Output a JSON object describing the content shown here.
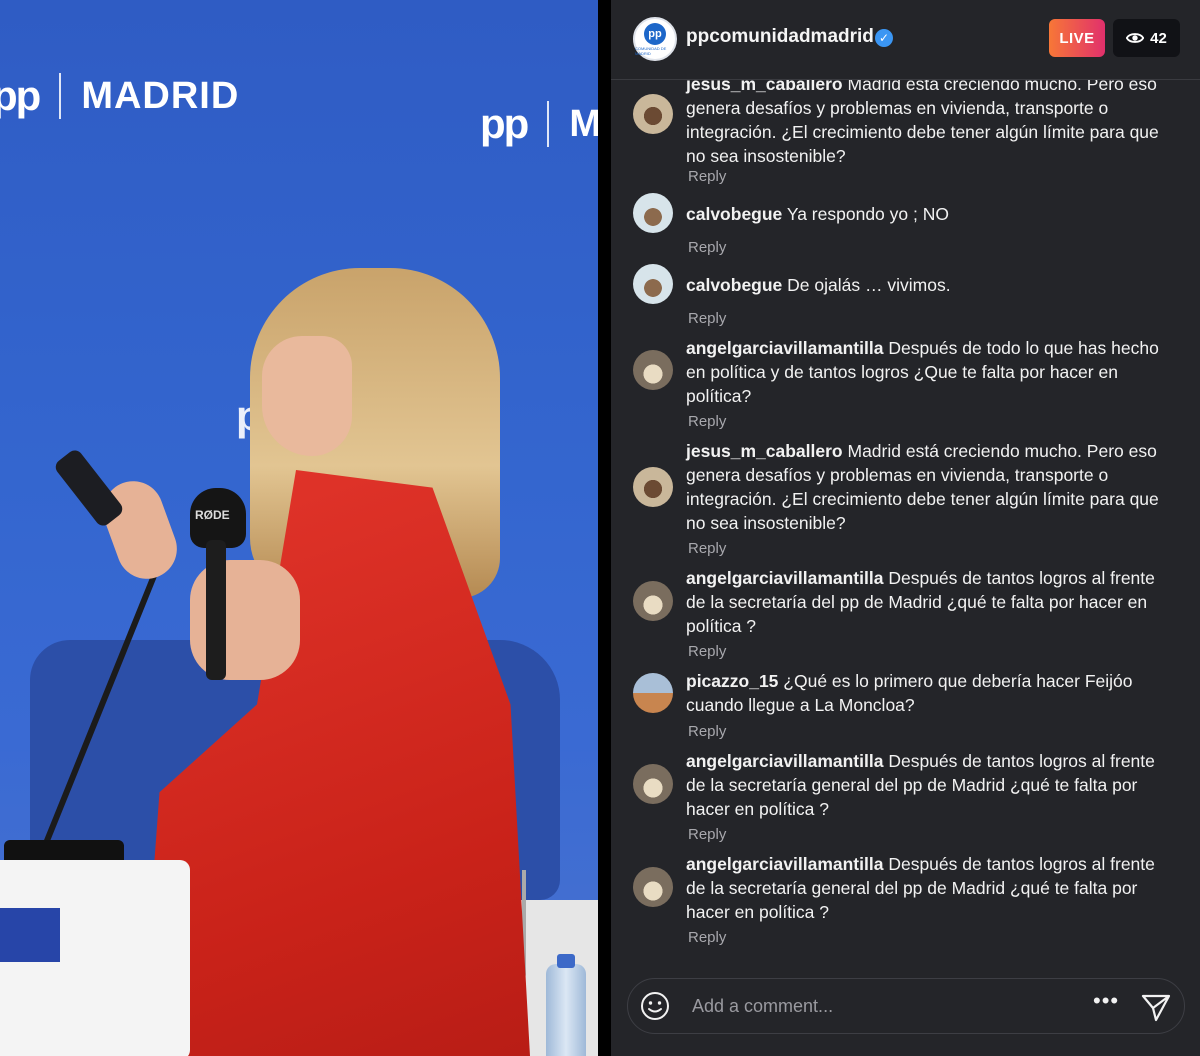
{
  "video": {
    "brand_mark": "pp",
    "brand_city": "MADRID",
    "mic_brand": "RØDE"
  },
  "header": {
    "username": "ppcomunidadmadrid",
    "live_label": "LIVE",
    "viewer_count": "42",
    "avatar_monogram": "pp",
    "avatar_caption": "COMUNIDAD DE MADRID"
  },
  "comments": [
    {
      "user": "jesus_m_caballero",
      "text": "Madrid está creciendo mucho. Pero eso genera desafíos y problemas en vivienda, transporte o integración. ¿El crecimiento debe tener algún límite para que no sea insostenible?",
      "reply": "Reply"
    },
    {
      "user": "calvobegue",
      "text": "Ya respondo yo ; NO",
      "reply": "Reply"
    },
    {
      "user": "calvobegue",
      "text": "De ojalás … vivimos.",
      "reply": "Reply"
    },
    {
      "user": "angelgarciavillamantilla",
      "text": "Después de todo lo que has hecho en política y de tantos logros ¿Que te falta por hacer en política?",
      "reply": "Reply"
    },
    {
      "user": "jesus_m_caballero",
      "text": "Madrid está creciendo mucho. Pero eso genera desafíos y problemas en vivienda, transporte o integración. ¿El crecimiento debe tener algún límite para que no sea insostenible?",
      "reply": "Reply"
    },
    {
      "user": "angelgarciavillamantilla",
      "text": "Después de tantos logros al frente de la secretaría del pp de Madrid ¿qué te falta por hacer en política ?",
      "reply": "Reply"
    },
    {
      "user": "picazzo_15",
      "text": "¿Qué es lo primero que debería hacer Feijóo cuando llegue a La Moncloa?",
      "reply": "Reply"
    },
    {
      "user": "angelgarciavillamantilla",
      "text": "Después de tantos logros al frente de la secretaría general del pp de Madrid ¿qué te falta por hacer en política ?",
      "reply": "Reply"
    },
    {
      "user": "angelgarciavillamantilla",
      "text": "Después de tantos logros al frente de la secretaría general del pp de Madrid ¿qué te falta por hacer en política ?",
      "reply": "Reply"
    }
  ],
  "composer": {
    "placeholder": "Add a comment...",
    "more_label": "•••"
  },
  "colors": {
    "panel_bg": "#242529",
    "live_gradient_start": "#f77737",
    "live_gradient_end": "#e1306c",
    "verified": "#3b96f3",
    "backdrop": "#3466cf",
    "dress": "#d92a20"
  },
  "icons": {
    "verified": "verified-badge-icon",
    "viewers": "eye-icon",
    "emoji": "emoji-icon",
    "more": "more-options-icon",
    "send": "send-icon"
  }
}
